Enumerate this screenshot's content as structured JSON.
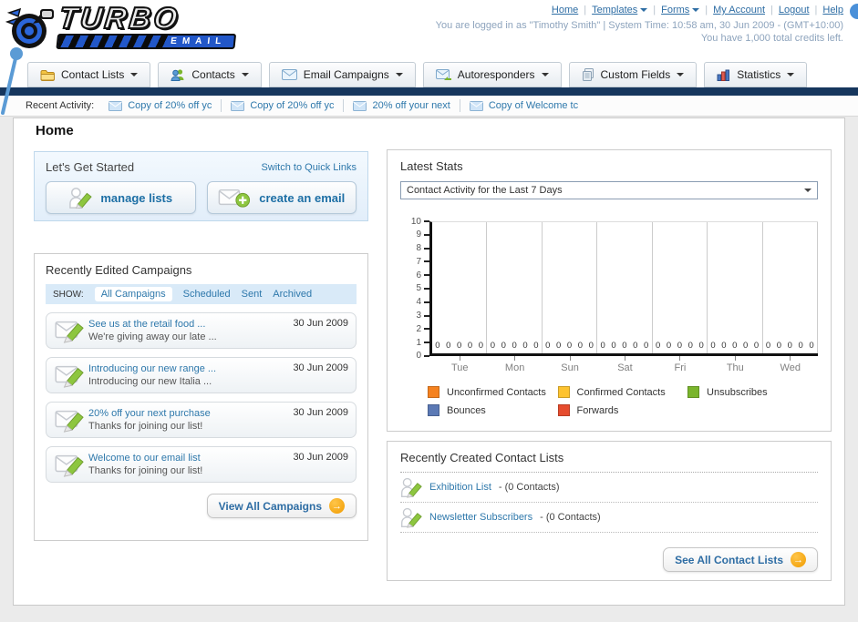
{
  "brand": {
    "navy": "#16365d",
    "link_blue": "#2e6da4",
    "accent_orange": "#f09b00",
    "light_blue": "#4a90d9"
  },
  "header": {
    "logo": {
      "line1": "TURBO",
      "line2": "EMAIL"
    },
    "nav_links": [
      "Home",
      "Templates",
      "Forms",
      "My Account",
      "Logout",
      "Help"
    ],
    "login_info": "You are logged in as \"Timothy Smith\" | System Time: 10:58 am, 30 Jun 2009 - (GMT+10:00)",
    "credits_info": "You have 1,000 total credits left."
  },
  "main_nav": [
    {
      "label": "Contact Lists",
      "icon": "folder-icon"
    },
    {
      "label": "Contacts",
      "icon": "contacts-icon"
    },
    {
      "label": "Email Campaigns",
      "icon": "envelope-icon"
    },
    {
      "label": "Autoresponders",
      "icon": "autoresponder-icon"
    },
    {
      "label": "Custom Fields",
      "icon": "custom-fields-icon"
    },
    {
      "label": "Statistics",
      "icon": "statistics-icon"
    }
  ],
  "recent_activity": {
    "label": "Recent Activity:",
    "items": [
      "Copy of 20% off yc",
      "Copy of 20% off yc",
      "20% off your next",
      "Copy of Welcome tc"
    ]
  },
  "page_title": "Home",
  "get_started": {
    "title": "Let's Get Started",
    "switch_link": "Switch to Quick Links",
    "manage_lists_label": "manage lists",
    "create_email_label": "create an email"
  },
  "campaigns": {
    "title": "Recently Edited Campaigns",
    "show_label": "SHOW:",
    "filters": [
      "All Campaigns",
      "Scheduled",
      "Sent",
      "Archived"
    ],
    "active_filter": "All Campaigns",
    "items": [
      {
        "title": "See us at the retail food ...",
        "subtitle": "We're giving away our late ...",
        "date": "30 Jun 2009"
      },
      {
        "title": "Introducing our new range ...",
        "subtitle": "Introducing our new Italia ...",
        "date": "30 Jun 2009"
      },
      {
        "title": "20% off your next purchase",
        "subtitle": "Thanks for joining our list!",
        "date": "30 Jun 2009"
      },
      {
        "title": "Welcome to our email list",
        "subtitle": "Thanks for joining our list!",
        "date": "30 Jun 2009"
      }
    ],
    "view_all_label": "View All Campaigns"
  },
  "stats": {
    "title": "Latest Stats",
    "dropdown_value": "Contact Activity for the Last 7 Days",
    "chart_data": {
      "type": "bar",
      "title": "Contact Activity for the Last 7 Days",
      "categories": [
        "Tue",
        "Mon",
        "Sun",
        "Sat",
        "Fri",
        "Thu",
        "Wed"
      ],
      "series": [
        {
          "name": "Unconfirmed Contacts",
          "color": "#f58220",
          "values": [
            0,
            0,
            0,
            0,
            0,
            0,
            0
          ]
        },
        {
          "name": "Confirmed Contacts",
          "color": "#fdc330",
          "values": [
            0,
            0,
            0,
            0,
            0,
            0,
            0
          ]
        },
        {
          "name": "Unsubscribes",
          "color": "#7ab52c",
          "values": [
            0,
            0,
            0,
            0,
            0,
            0,
            0
          ]
        },
        {
          "name": "Bounces",
          "color": "#5b79b5",
          "values": [
            0,
            0,
            0,
            0,
            0,
            0,
            0
          ]
        },
        {
          "name": "Forwards",
          "color": "#e64c2e",
          "values": [
            0,
            0,
            0,
            0,
            0,
            0,
            0
          ]
        }
      ],
      "ylim": [
        0,
        10
      ],
      "yticks": [
        0,
        1,
        2,
        3,
        4,
        5,
        6,
        7,
        8,
        9,
        10
      ],
      "grid": true,
      "legend_position": "bottom"
    }
  },
  "contact_lists": {
    "title": "Recently Created Contact Lists",
    "items": [
      {
        "name": "Exhibition List",
        "detail": "- (0 Contacts)"
      },
      {
        "name": "Newsletter Subscribers",
        "detail": "- (0 Contacts)"
      }
    ],
    "see_all_label": "See All Contact Lists"
  }
}
